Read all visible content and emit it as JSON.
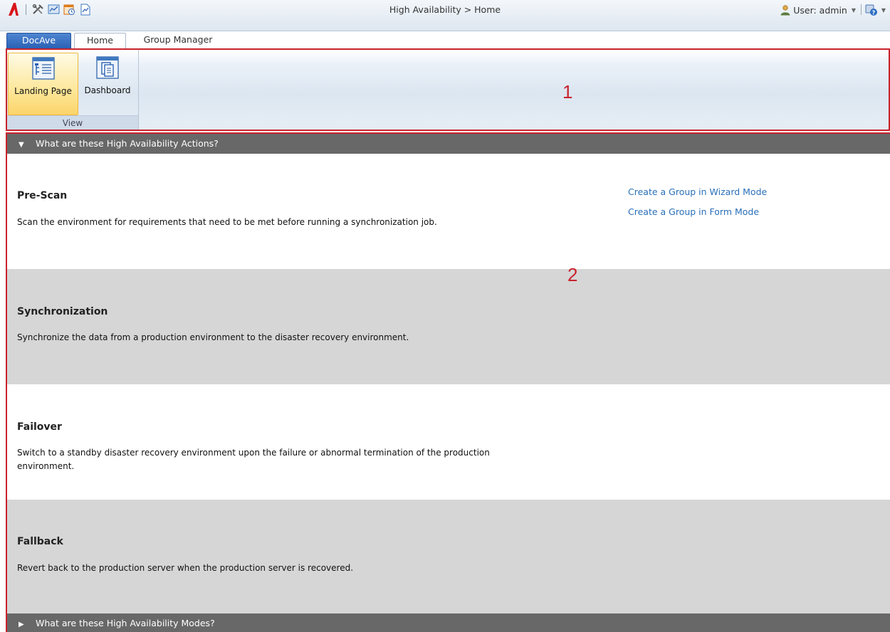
{
  "breadcrumb": "High Availability > Home",
  "user": {
    "label": "User: admin"
  },
  "tabs": [
    {
      "label": "DocAve"
    },
    {
      "label": "Home"
    },
    {
      "label": "Group Manager"
    }
  ],
  "ribbon": {
    "buttons": [
      {
        "label": "Landing Page"
      },
      {
        "label": "Dashboard"
      }
    ],
    "group_label": "View",
    "marker": "1"
  },
  "main": {
    "actions_header": "What are these High Availability Actions?",
    "modes_header": "What are these High Availability Modes?",
    "marker": "2",
    "actions": [
      {
        "title": "Pre-Scan",
        "desc": "Scan the environment for requirements that need to be met before running a synchronization job."
      },
      {
        "title": "Synchronization",
        "desc": "Synchronize the data from a production environment to the disaster recovery environment."
      },
      {
        "title": "Failover",
        "desc": "Switch to a standby disaster recovery environment upon the failure or abnormal termination of the production environment."
      },
      {
        "title": "Fallback",
        "desc": "Revert back to the production server when the production server is recovered."
      }
    ],
    "links": [
      {
        "label": "Create a Group in Wizard Mode"
      },
      {
        "label": "Create a Group in Form Mode"
      }
    ]
  },
  "colors": {
    "accent_blue": "#2a61b5",
    "link": "#2a6fb8",
    "highlight_red": "#c8232c",
    "section_header": "#686868",
    "block_gray": "#d6d6d6"
  }
}
